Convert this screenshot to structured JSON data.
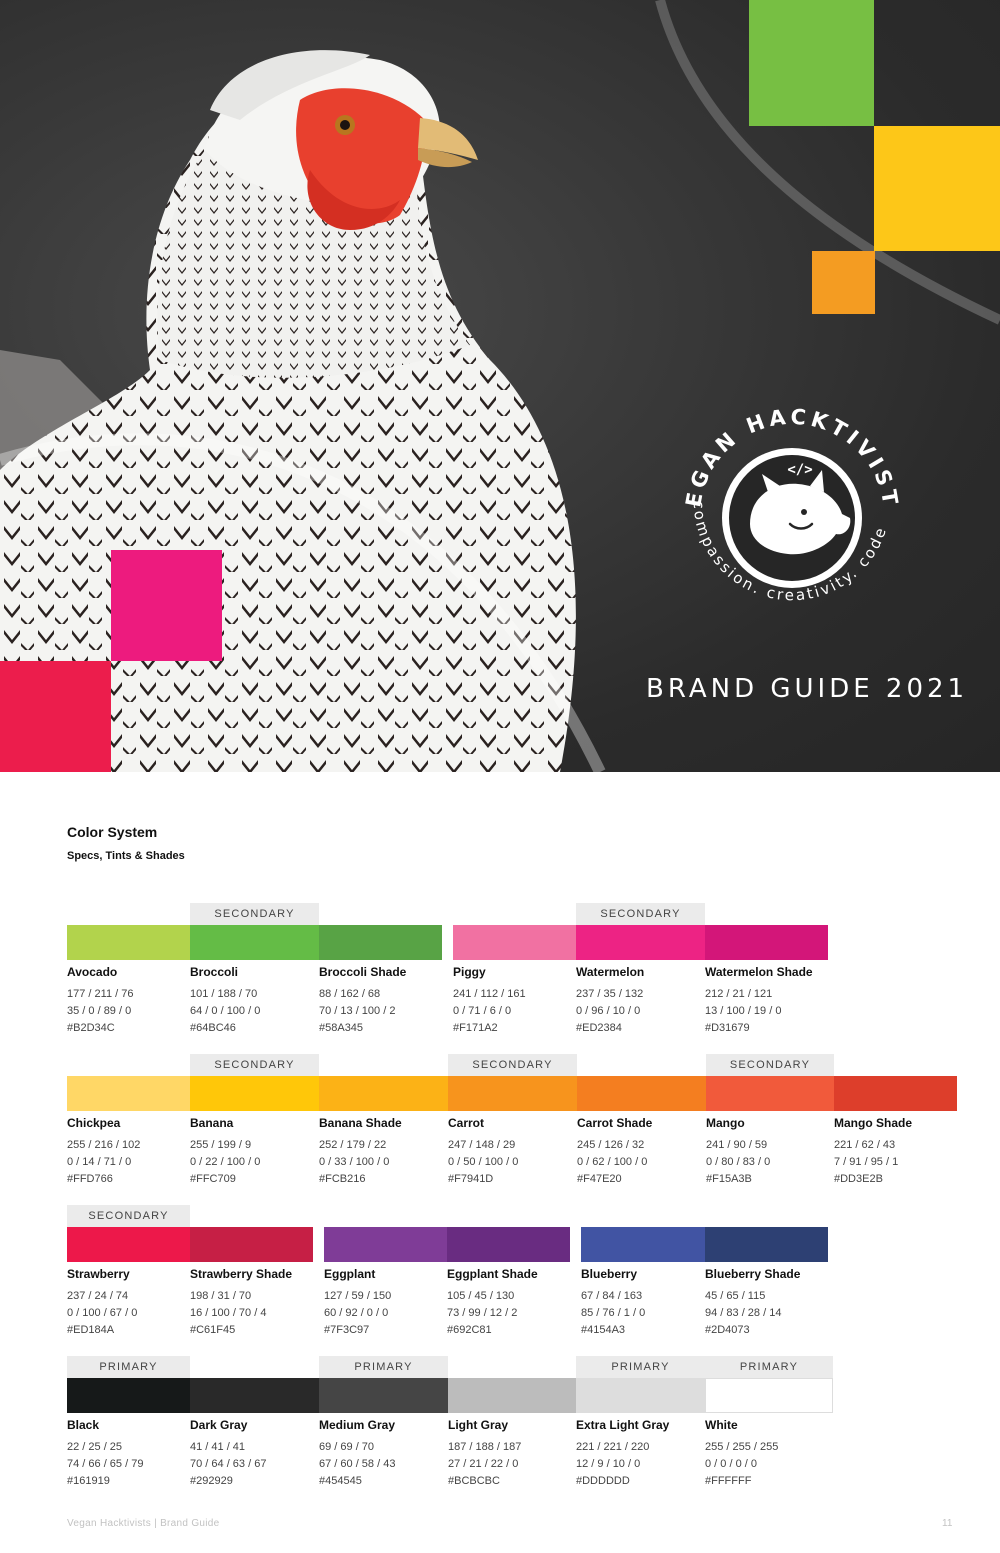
{
  "hero": {
    "badge": {
      "top_text": "VEGAN HACKTIVISTS",
      "bottom_text": "compassion. creativity. code.",
      "code_symbol": "</>"
    },
    "title": "BRAND GUIDE 2021"
  },
  "color_system": {
    "title": "Color System",
    "subtitle": "Specs, Tints & Shades",
    "swatches": [
      {
        "name": "Avocado",
        "rgb": "177 / 211 / 76",
        "cmyk": "35 / 0 / 89 / 0",
        "hex": "#B2D34C",
        "color": "#B2D34C",
        "tag": ""
      },
      {
        "name": "Broccoli",
        "rgb": "101 / 188 / 70",
        "cmyk": "64 / 0 / 100 / 0",
        "hex": "#64BC46",
        "color": "#64BC46",
        "tag": "SECONDARY"
      },
      {
        "name": "Broccoli Shade",
        "rgb": "88 / 162 / 68",
        "cmyk": "70 / 13 / 100 / 2",
        "hex": "#58A345",
        "color": "#58A345",
        "tag": ""
      },
      {
        "name": "Piggy",
        "rgb": "241 / 112 / 161",
        "cmyk": "0 / 71 / 6 / 0",
        "hex": "#F171A2",
        "color": "#F171A2",
        "tag": ""
      },
      {
        "name": "Watermelon",
        "rgb": "237 / 35 / 132",
        "cmyk": "0 / 96 / 10 / 0",
        "hex": "#ED2384",
        "color": "#ED2384",
        "tag": "SECONDARY"
      },
      {
        "name": "Watermelon Shade",
        "rgb": "212 / 21 / 121",
        "cmyk": "13 / 100 / 19 / 0",
        "hex": "#D31679",
        "color": "#D31679",
        "tag": ""
      },
      {
        "name": "Chickpea",
        "rgb": "255 / 216 / 102",
        "cmyk": "0 / 14 / 71 / 0",
        "hex": "#FFD766",
        "color": "#FFD766",
        "tag": ""
      },
      {
        "name": "Banana",
        "rgb": "255 / 199 / 9",
        "cmyk": "0 / 22 / 100 / 0",
        "hex": "#FFC709",
        "color": "#FFC709",
        "tag": "SECONDARY"
      },
      {
        "name": "Banana Shade",
        "rgb": "252 / 179 / 22",
        "cmyk": "0 / 33 / 100 / 0",
        "hex": "#FCB216",
        "color": "#FCB216",
        "tag": ""
      },
      {
        "name": "Carrot",
        "rgb": "247 / 148 / 29",
        "cmyk": "0 / 50 / 100 / 0",
        "hex": "#F7941D",
        "color": "#F7941D",
        "tag": "SECONDARY"
      },
      {
        "name": "Carrot Shade",
        "rgb": "245 / 126 / 32",
        "cmyk": "0 / 62 / 100 / 0",
        "hex": "#F47E20",
        "color": "#F47E20",
        "tag": ""
      },
      {
        "name": "Mango",
        "rgb": "241 / 90 / 59",
        "cmyk": "0 / 80 / 83 / 0",
        "hex": "#F15A3B",
        "color": "#F15A3B",
        "tag": "SECONDARY"
      },
      {
        "name": "Mango Shade",
        "rgb": "221 / 62 / 43",
        "cmyk": "7 / 91 / 95 / 1",
        "hex": "#DD3E2B",
        "color": "#DD3E2B",
        "tag": ""
      },
      {
        "name": "Strawberry",
        "rgb": "237 / 24 / 74",
        "cmyk": "0 / 100 / 67 / 0",
        "hex": "#ED184A",
        "color": "#ED184A",
        "tag": "SECONDARY"
      },
      {
        "name": "Strawberry Shade",
        "rgb": "198 / 31 / 70",
        "cmyk": "16 / 100 / 70 / 4",
        "hex": "#C61F45",
        "color": "#C61F45",
        "tag": ""
      },
      {
        "name": "Eggplant",
        "rgb": "127 / 59 / 150",
        "cmyk": "60 / 92 / 0 / 0",
        "hex": "#7F3C97",
        "color": "#7F3C97",
        "tag": ""
      },
      {
        "name": "Eggplant Shade",
        "rgb": "105 / 45 / 130",
        "cmyk": "73 / 99 / 12 / 2",
        "hex": "#692C81",
        "color": "#692C81",
        "tag": ""
      },
      {
        "name": "Blueberry",
        "rgb": "67 / 84 / 163",
        "cmyk": "85 / 76 / 1 / 0",
        "hex": "#4154A3",
        "color": "#4154A3",
        "tag": ""
      },
      {
        "name": "Blueberry Shade",
        "rgb": "45 / 65 / 115",
        "cmyk": "94 / 83 / 28 / 14",
        "hex": "#2D4073",
        "color": "#2D4073",
        "tag": ""
      },
      {
        "name": "Black",
        "rgb": "22 / 25 / 25",
        "cmyk": "74 / 66 / 65 / 79",
        "hex": "#161919",
        "color": "#161919",
        "tag": "PRIMARY"
      },
      {
        "name": "Dark Gray",
        "rgb": "41 / 41 / 41",
        "cmyk": "70 / 64 / 63 / 67",
        "hex": "#292929",
        "color": "#292929",
        "tag": ""
      },
      {
        "name": "Medium Gray",
        "rgb": "69 / 69 / 70",
        "cmyk": "67 / 60 / 58 / 43",
        "hex": "#454545",
        "color": "#454545",
        "tag": "PRIMARY"
      },
      {
        "name": "Light Gray",
        "rgb": "187 / 188 / 187",
        "cmyk": "27 / 21 / 22 / 0",
        "hex": "#BCBCBC",
        "color": "#BCBCBC",
        "tag": ""
      },
      {
        "name": "Extra Light Gray",
        "rgb": "221 / 221 / 220",
        "cmyk": "12 / 9 / 10 / 0",
        "hex": "#DDDDDD",
        "color": "#DDDDDD",
        "tag": "PRIMARY"
      },
      {
        "name": "White",
        "rgb": "255 / 255 / 255",
        "cmyk": "0 / 0 / 0 / 0",
        "hex": "#FFFFFF",
        "color": "#FFFFFF",
        "tag": "PRIMARY"
      }
    ]
  },
  "footer": {
    "left": "Vegan Hacktivists | Brand Guide",
    "page_number": "11"
  }
}
